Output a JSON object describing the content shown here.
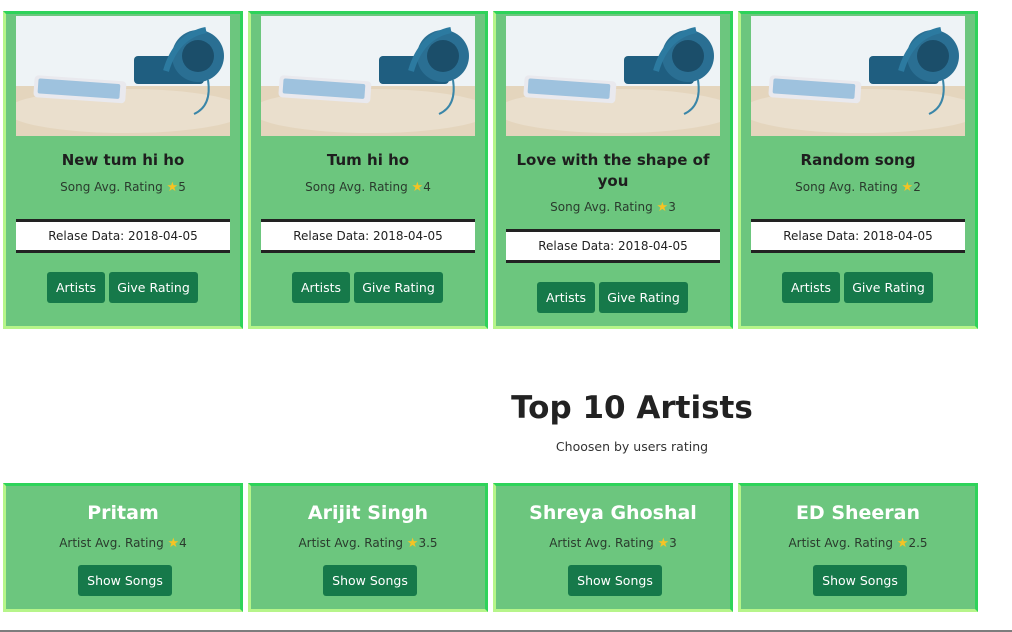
{
  "songs": [
    {
      "title": "New tum hi ho",
      "rating_label": "Song Avg. Rating",
      "rating": "5",
      "release": "Relase Data: 2018-04-05",
      "artists_label": "Artists",
      "rate_label": "Give Rating"
    },
    {
      "title": "Tum hi ho",
      "rating_label": "Song Avg. Rating",
      "rating": "4",
      "release": "Relase Data: 2018-04-05",
      "artists_label": "Artists",
      "rate_label": "Give Rating"
    },
    {
      "title": "Love with the shape of you",
      "rating_label": "Song Avg. Rating",
      "rating": "3",
      "release": "Relase Data: 2018-04-05",
      "artists_label": "Artists",
      "rate_label": "Give Rating"
    },
    {
      "title": "Random song",
      "rating_label": "Song Avg. Rating",
      "rating": "2",
      "release": "Relase Data: 2018-04-05",
      "artists_label": "Artists",
      "rate_label": "Give Rating"
    }
  ],
  "section": {
    "title": "Top 10 Artists",
    "subtitle": "Choosen by users rating"
  },
  "artists": [
    {
      "name": "Pritam",
      "rating_label": "Artist Avg. Rating",
      "rating": "4",
      "button": "Show Songs"
    },
    {
      "name": "Arijit Singh",
      "rating_label": "Artist Avg. Rating",
      "rating": "3.5",
      "button": "Show Songs"
    },
    {
      "name": "Shreya Ghoshal",
      "rating_label": "Artist Avg. Rating",
      "rating": "3",
      "button": "Show Songs"
    },
    {
      "name": "ED Sheeran",
      "rating_label": "Artist Avg. Rating",
      "rating": "2.5",
      "button": "Show Songs"
    }
  ],
  "icons": {
    "star": "star-icon",
    "thumbnail": "headphones-phone-image"
  },
  "colors": {
    "card_bg": "#6cc67e",
    "card_border": "#2ed35a",
    "button_bg": "#16794a",
    "star": "#f6c324"
  }
}
